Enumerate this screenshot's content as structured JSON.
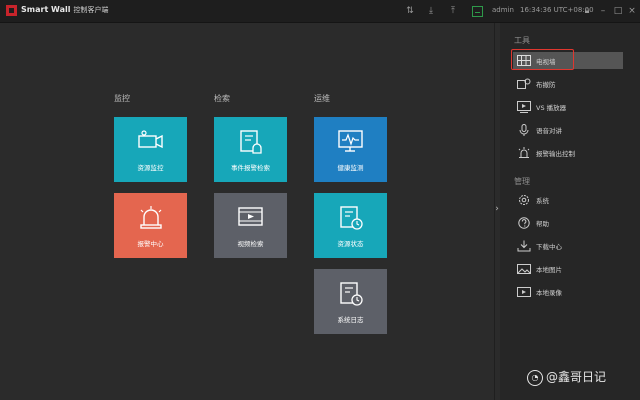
{
  "app": {
    "title": "Smart Wall",
    "subtitle": "控制客户端"
  },
  "topbar": {
    "user": "admin",
    "time": "16:34:36 UTC+08:00"
  },
  "columns": [
    {
      "label": "监控"
    },
    {
      "label": "检索"
    },
    {
      "label": "运维"
    }
  ],
  "tiles": {
    "resource_monitor": "资源监控",
    "alarm_center": "报警中心",
    "event_alarm_search": "事件报警检索",
    "video_search": "视频检索",
    "health_monitor": "健康监测",
    "resource_status": "资源状态",
    "system_log": "系统日志"
  },
  "sidebar": {
    "tools_heading": "工具",
    "tools": [
      {
        "label": "电视墙",
        "icon": "tv-wall-icon"
      },
      {
        "label": "布撤防",
        "icon": "arm-disarm-icon"
      },
      {
        "label": "VS 播放器",
        "icon": "player-icon"
      },
      {
        "label": "语音对讲",
        "icon": "microphone-icon"
      },
      {
        "label": "报警输出控制",
        "icon": "alarm-light-icon"
      }
    ],
    "manage_heading": "管理",
    "manage": [
      {
        "label": "系统",
        "icon": "gear-icon"
      },
      {
        "label": "帮助",
        "icon": "help-icon"
      },
      {
        "label": "下载中心",
        "icon": "download-icon"
      },
      {
        "label": "本地图片",
        "icon": "image-icon"
      },
      {
        "label": "本地录像",
        "icon": "video-file-icon"
      }
    ]
  },
  "watermark": {
    "text": "@鑫哥日记"
  },
  "colors": {
    "teal": "#17a7b9",
    "red": "#e4664f",
    "gray": "#5d6068",
    "blue": "#1f7fc2",
    "highlight": "#e0372f"
  }
}
